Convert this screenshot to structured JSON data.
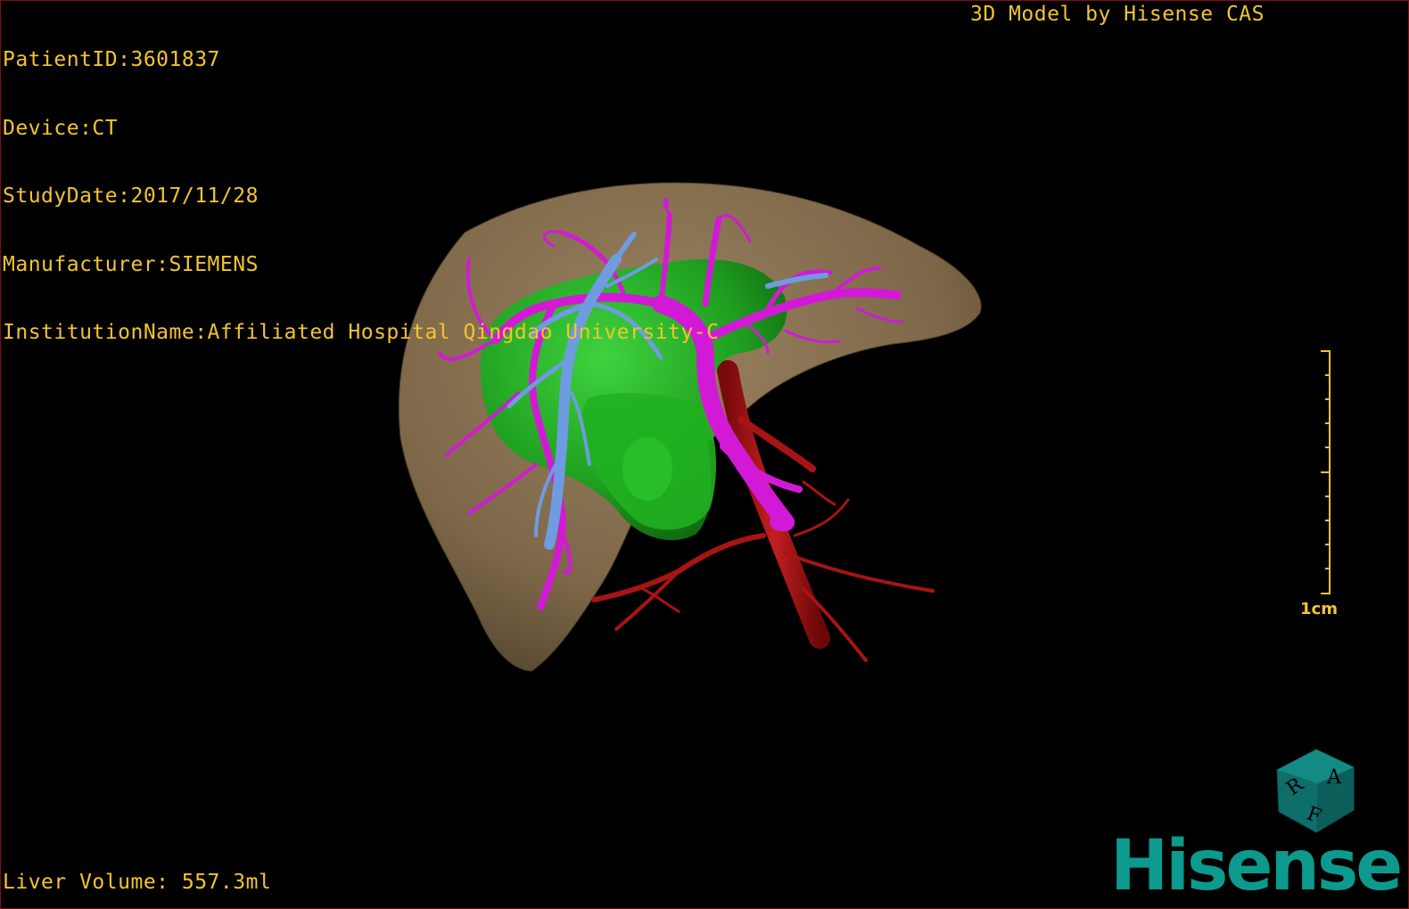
{
  "header": {
    "patient_id": "PatientID:3601837",
    "device": "Device:CT",
    "study_date": "StudyDate:2017/11/28",
    "manufacturer": "Manufacturer:SIEMENS",
    "institution": "InstitutionName:Affiliated Hospital Qingdao University-C",
    "credit": "3D Model by Hisense CAS"
  },
  "footer": {
    "liver_volume": "Liver Volume: 557.3ml",
    "brand": "Hisense"
  },
  "scale": {
    "label": "1cm"
  },
  "orientation_cube": {
    "labels": [
      "A",
      "R",
      "F"
    ]
  },
  "colors": {
    "overlay_text": "#f4c430",
    "liver": "#8a7352",
    "tumor": "#1fa81f",
    "portal_vein": "#d21ad6",
    "hepatic_vein": "#6f9be0",
    "artery": "#b01515",
    "brand": "#0c9a8e"
  },
  "icons": [
    "orientation-cube-icon",
    "scale-bar-icon",
    "hisense-logo-icon"
  ]
}
